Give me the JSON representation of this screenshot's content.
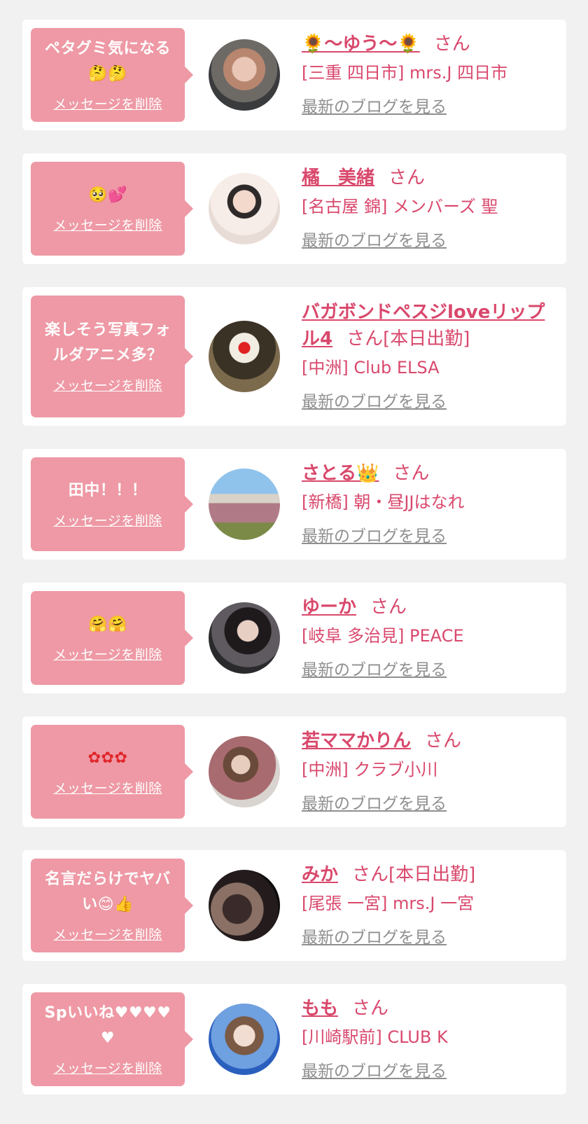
{
  "items": [
    {
      "message": "ペタグミ気になる🤔🤔",
      "delete_label": "メッセージを削除",
      "name": "🌻〜ゆう〜🌻",
      "honorific": "さん",
      "status": "",
      "shop": "[三重 四日市] mrs.J 四日市",
      "blog_label": "最新のブログを見る"
    },
    {
      "message": "🥺💕",
      "delete_label": "メッセージを削除",
      "name": "橘　美緒",
      "honorific": "さん",
      "status": "",
      "shop": "[名古屋 錦] メンバーズ 聖",
      "blog_label": "最新のブログを見る"
    },
    {
      "message": "楽しそう写真フォルダアニメ多？",
      "delete_label": "メッセージを削除",
      "name": "バガボンドペスジloveリップル4",
      "honorific": "さん",
      "status": "[本日出勤]",
      "shop": "[中洲] Club ELSA",
      "blog_label": "最新のブログを見る"
    },
    {
      "message": "田中！！！",
      "delete_label": "メッセージを削除",
      "name": "さとる👑",
      "honorific": "さん",
      "status": "",
      "shop": "[新橋] 朝・昼JJはなれ",
      "blog_label": "最新のブログを見る"
    },
    {
      "message": "🤗🤗",
      "delete_label": "メッセージを削除",
      "name": "ゆーか",
      "honorific": "さん",
      "status": "",
      "shop": "[岐阜 多治見] PEACE",
      "blog_label": "最新のブログを見る"
    },
    {
      "message": "✿✿✿",
      "delete_label": "メッセージを削除",
      "name": "若ママかりん",
      "honorific": "さん",
      "status": "",
      "shop": "[中洲] クラブ小川",
      "blog_label": "最新のブログを見る"
    },
    {
      "message": "名言だらけでヤバい😊👍",
      "delete_label": "メッセージを削除",
      "name": "みか",
      "honorific": "さん",
      "status": "[本日出勤]",
      "shop": "[尾張 一宮] mrs.J 一宮",
      "blog_label": "最新のブログを見る"
    },
    {
      "message": "Spいいね♥♥♥♥♥",
      "delete_label": "メッセージを削除",
      "name": "もも",
      "honorific": "さん",
      "status": "",
      "shop": "[川崎駅前] CLUB K",
      "blog_label": "最新のブログを見る"
    }
  ],
  "colors": {
    "background": "#f1f1f1",
    "card": "#ffffff",
    "bubble": "#ee99a5",
    "accent": "#d9486c",
    "blog_link": "#8f8f8f"
  }
}
